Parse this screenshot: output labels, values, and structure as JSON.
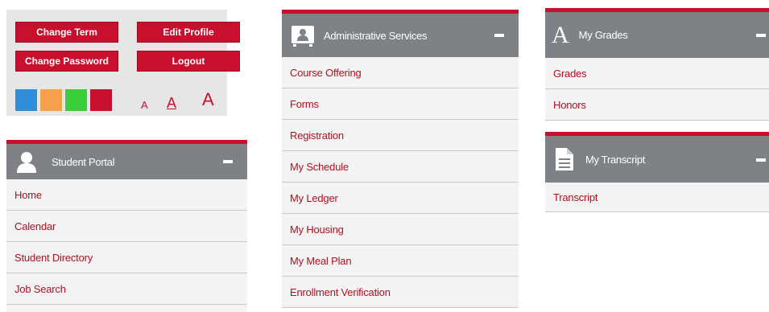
{
  "account": {
    "change_term": "Change Term",
    "edit_profile": "Edit Profile",
    "change_password": "Change Password",
    "logout": "Logout",
    "theme_colors": [
      "#2e8fd8",
      "#f7a04b",
      "#3acd3a",
      "#c8102e"
    ],
    "font_sizes": [
      "A",
      "A",
      "A"
    ]
  },
  "student_portal": {
    "title": "Student Portal",
    "items": [
      "Home",
      "Calendar",
      "Student Directory",
      "Job Search"
    ]
  },
  "admin_services": {
    "title": "Administrative Services",
    "items": [
      "Course Offering",
      "Forms",
      "Registration",
      "My Schedule",
      "My Ledger",
      "My Housing",
      "My Meal Plan",
      "Enrollment Verification"
    ]
  },
  "my_grades": {
    "title": "My Grades",
    "icon_letter": "A",
    "items": [
      "Grades",
      "Honors"
    ]
  },
  "my_transcript": {
    "title": "My Transcript",
    "items": [
      "Transcript"
    ]
  },
  "colors": {
    "accent": "#c8102e",
    "header_gray": "#7e8186",
    "link": "#b01020"
  }
}
